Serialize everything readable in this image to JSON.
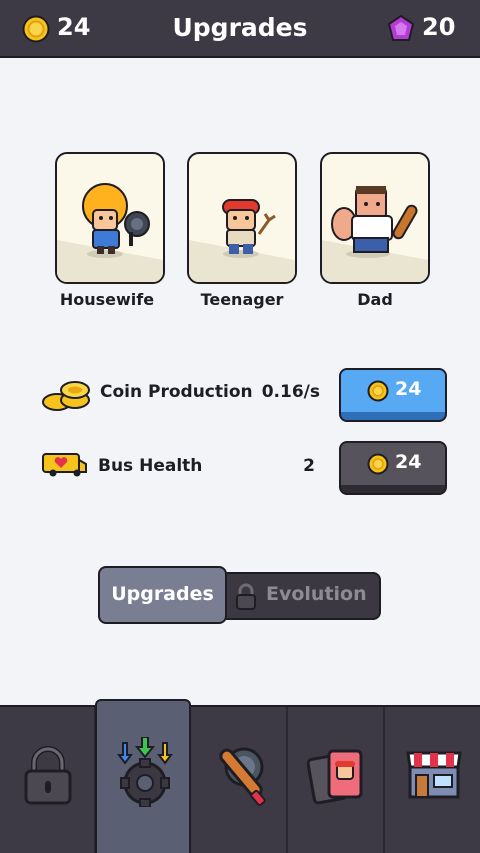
{
  "header": {
    "coins": "24",
    "title": "Upgrades",
    "gems": "20",
    "coin_icon": "coin-icon",
    "gem_icon": "purple-gem-icon"
  },
  "characters": [
    {
      "name": "Housewife",
      "icon": "housewife-with-frying-pan"
    },
    {
      "name": "Teenager",
      "icon": "teenager-with-slingshot"
    },
    {
      "name": "Dad",
      "icon": "dad-with-baseball-bat"
    }
  ],
  "upgrades": [
    {
      "label": "Coin Production",
      "value": "0.16/s",
      "price": "24",
      "icon": "coin-stack-icon",
      "affordable": true
    },
    {
      "label": "Bus Health",
      "value": "2",
      "price": "24",
      "icon": "bus-heart-icon",
      "affordable": false
    }
  ],
  "toggle": {
    "upgrades_label": "Upgrades",
    "evolution_label": "Evolution"
  },
  "nav": [
    {
      "icon": "lock-icon"
    },
    {
      "icon": "upgrade-gear-icon",
      "active": true
    },
    {
      "icon": "bat-and-pan-icon"
    },
    {
      "icon": "character-cards-icon"
    },
    {
      "icon": "shop-icon"
    }
  ],
  "colors": {
    "background": "#f2f4f8",
    "header": "#3d3a46",
    "coin": "#f6c21c",
    "gem": "#b43cd6",
    "buy_affordable": "#56a9f2",
    "buy_locked": "#57535d",
    "active_tab": "#7a7e93"
  }
}
